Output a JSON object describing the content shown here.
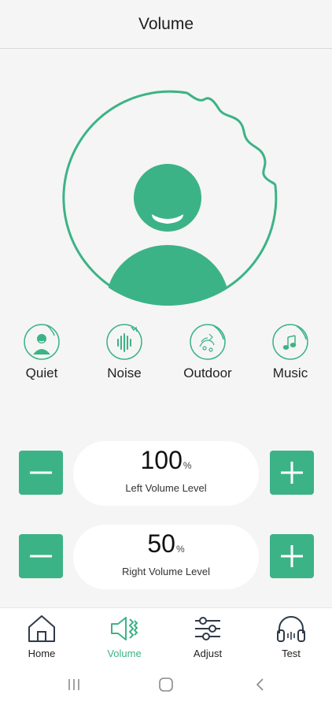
{
  "header": {
    "title": "Volume"
  },
  "colors": {
    "accent": "#3cb386",
    "background": "#f5f5f5",
    "pill": "#ffffff"
  },
  "hero": {
    "icon": "person-hearing-icon"
  },
  "modes": [
    {
      "label": "Quiet",
      "icon": "quiet-person-icon"
    },
    {
      "label": "Noise",
      "icon": "noise-icon"
    },
    {
      "label": "Outdoor",
      "icon": "outdoor-icon"
    },
    {
      "label": "Music",
      "icon": "music-note-icon"
    }
  ],
  "left_volume": {
    "value": "100",
    "unit": "%",
    "label": "Left Volume Level"
  },
  "right_volume": {
    "value": "50",
    "unit": "%",
    "label": "Right Volume Level"
  },
  "tabs": [
    {
      "label": "Home",
      "icon": "home-icon"
    },
    {
      "label": "Volume",
      "icon": "speaker-icon",
      "active": true
    },
    {
      "label": "Adjust",
      "icon": "sliders-icon"
    },
    {
      "label": "Test",
      "icon": "headphones-icon"
    }
  ],
  "system_nav": [
    "recents-icon",
    "home-circle-icon",
    "back-icon"
  ]
}
